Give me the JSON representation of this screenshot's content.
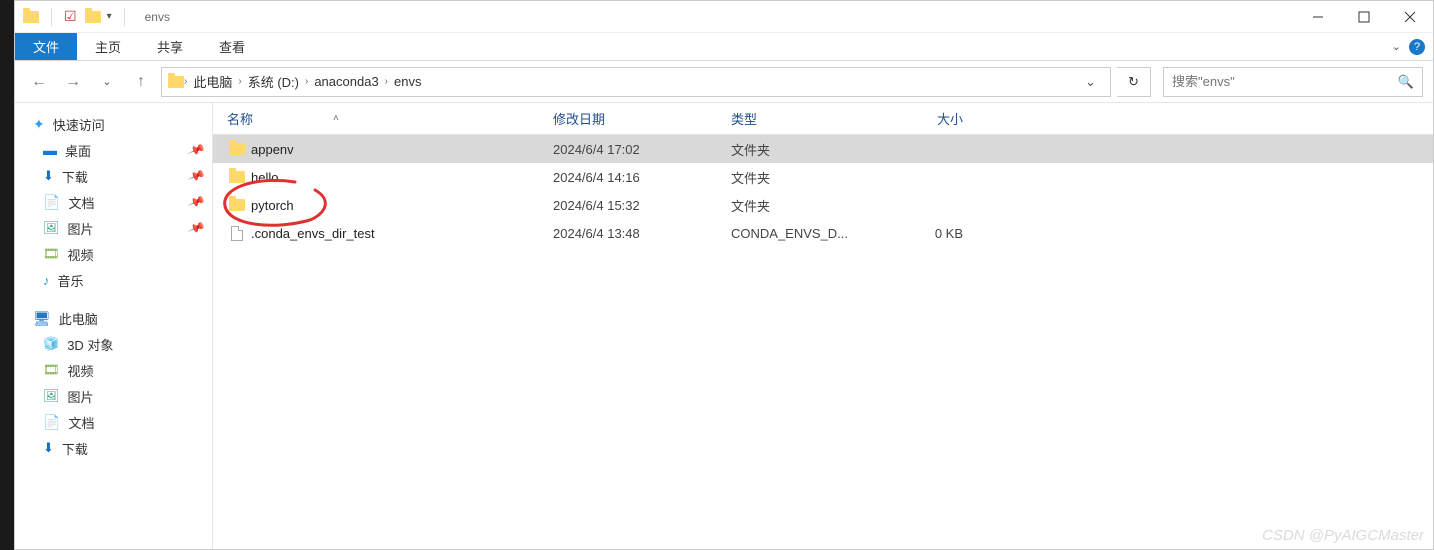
{
  "titlebar": {
    "title": "envs"
  },
  "ribbon": {
    "tabs": [
      "文件",
      "主页",
      "共享",
      "查看"
    ]
  },
  "breadcrumb": {
    "items": [
      "此电脑",
      "系统 (D:)",
      "anaconda3",
      "envs"
    ]
  },
  "search": {
    "placeholder": "搜索\"envs\""
  },
  "sidebar": {
    "quick": "快速访问",
    "quick_items": [
      "桌面",
      "下载",
      "文档",
      "图片",
      "视频",
      "音乐"
    ],
    "thispc": "此电脑",
    "pc_items": [
      "3D 对象",
      "视频",
      "图片",
      "文档",
      "下载"
    ]
  },
  "columns": {
    "name": "名称",
    "date": "修改日期",
    "type": "类型",
    "size": "大小"
  },
  "rows": [
    {
      "icon": "folder",
      "name": "appenv",
      "date": "2024/6/4 17:02",
      "type": "文件夹",
      "size": "",
      "selected": true
    },
    {
      "icon": "folder",
      "name": "hello",
      "date": "2024/6/4 14:16",
      "type": "文件夹",
      "size": "",
      "selected": false
    },
    {
      "icon": "folder",
      "name": "pytorch",
      "date": "2024/6/4 15:32",
      "type": "文件夹",
      "size": "",
      "selected": false
    },
    {
      "icon": "file",
      "name": ".conda_envs_dir_test",
      "date": "2024/6/4 13:48",
      "type": "CONDA_ENVS_D...",
      "size": "0 KB",
      "selected": false
    }
  ],
  "watermark": "CSDN @PyAIGCMaster"
}
